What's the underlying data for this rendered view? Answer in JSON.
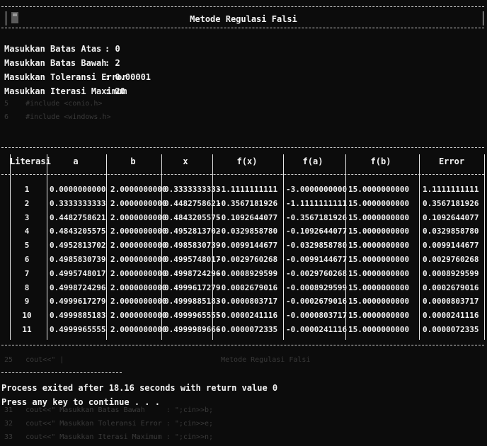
{
  "title": "Metode Regulasi Falsi",
  "inputs": [
    {
      "label": "Masukkan Batas Atas",
      "value": "0"
    },
    {
      "label": "Masukkan Batas Bawah",
      "value": "2"
    },
    {
      "label": "Masukkan Toleransi Error",
      "value": "0.00001"
    },
    {
      "label": "Masukkan Iterasi Maximum",
      "value": "20"
    }
  ],
  "table": {
    "columns": [
      "Literasi",
      "a",
      "b",
      "x",
      "f(x)",
      "f(a)",
      "f(b)",
      "Error"
    ],
    "rows": [
      [
        "1",
        "0.0000000000",
        "2.0000000000",
        "0.3333333333",
        "-1.1111111111",
        "-3.0000000000",
        "15.0000000000",
        "1.1111111111"
      ],
      [
        "2",
        "0.3333333333",
        "2.0000000000",
        "0.4482758621",
        "-0.3567181926",
        "-1.1111111111",
        "15.0000000000",
        "0.3567181926"
      ],
      [
        "3",
        "0.4482758621",
        "2.0000000000",
        "0.4843205575",
        "-0.1092644077",
        "-0.3567181926",
        "15.0000000000",
        "0.1092644077"
      ],
      [
        "4",
        "0.4843205575",
        "2.0000000000",
        "0.4952813702",
        "-0.0329858780",
        "-0.1092644077",
        "15.0000000000",
        "0.0329858780"
      ],
      [
        "5",
        "0.4952813702",
        "2.0000000000",
        "0.4985830739",
        "-0.0099144677",
        "-0.0329858780",
        "15.0000000000",
        "0.0099144677"
      ],
      [
        "6",
        "0.4985830739",
        "2.0000000000",
        "0.4995748017",
        "-0.0029760268",
        "-0.0099144677",
        "15.0000000000",
        "0.0029760268"
      ],
      [
        "7",
        "0.4995748017",
        "2.0000000000",
        "0.4998724296",
        "-0.0008929599",
        "-0.0029760268",
        "15.0000000000",
        "0.0008929599"
      ],
      [
        "8",
        "0.4998724296",
        "2.0000000000",
        "0.4999617279",
        "-0.0002679016",
        "-0.0008929599",
        "15.0000000000",
        "0.0002679016"
      ],
      [
        "9",
        "0.4999617279",
        "2.0000000000",
        "0.4999885183",
        "-0.0000803717",
        "-0.0002679016",
        "15.0000000000",
        "0.0000803717"
      ],
      [
        "10",
        "0.4999885183",
        "2.0000000000",
        "0.4999965555",
        "-0.0000241116",
        "-0.0000803717",
        "15.0000000000",
        "0.0000241116"
      ],
      [
        "11",
        "0.4999965555",
        "2.0000000000",
        "0.4999989666",
        "-0.0000072335",
        "-0.0000241116",
        "15.0000000000",
        "0.0000072335"
      ]
    ]
  },
  "exit_message": "Process exited after 18.16 seconds with return value 0",
  "continue_message": "Press any key to continue . . .",
  "ghost_title": "Metode Regulasi Falsi"
}
